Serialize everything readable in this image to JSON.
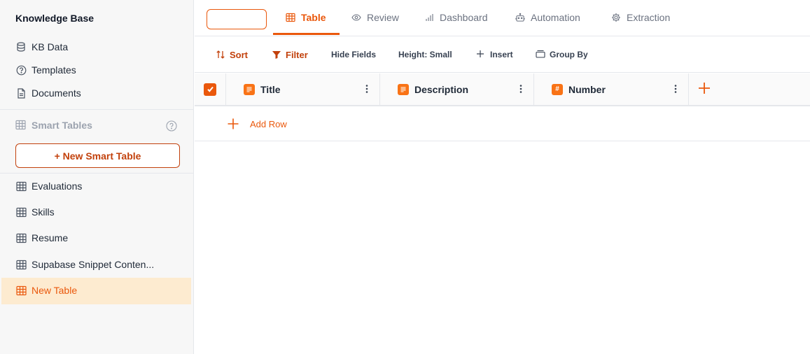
{
  "sidebar": {
    "title": "Knowledge Base",
    "nav": [
      {
        "label": "KB Data",
        "icon": "database-icon"
      },
      {
        "label": "Templates",
        "icon": "help-circle-icon"
      },
      {
        "label": "Documents",
        "icon": "document-icon"
      }
    ],
    "section_label": "Smart Tables",
    "new_table_label": "+ New Smart Table",
    "tables": [
      {
        "label": "Evaluations",
        "icon": "table-icon"
      },
      {
        "label": "Skills",
        "icon": "table-icon"
      },
      {
        "label": "Resume",
        "icon": "table-icon"
      },
      {
        "label": "Supabase Snippet Conten...",
        "icon": "table-icon"
      },
      {
        "label": "New Table",
        "icon": "table-icon",
        "active": true
      }
    ]
  },
  "header": {
    "name_input": {
      "value": "",
      "placeholder": ""
    },
    "tabs": [
      {
        "label": "Table",
        "icon": "table-icon",
        "active": true
      },
      {
        "label": "Review",
        "icon": "eye-icon"
      },
      {
        "label": "Dashboard",
        "icon": "bar-chart-icon"
      },
      {
        "label": "Automation",
        "icon": "robot-icon"
      },
      {
        "label": "Extraction",
        "icon": "gear-icon"
      }
    ]
  },
  "toolbar": {
    "sort": "Sort",
    "filter": "Filter",
    "hide_fields": "Hide Fields",
    "height": "Height: Small",
    "insert": "Insert",
    "group_by": "Group By"
  },
  "grid": {
    "columns": [
      {
        "label": "Title",
        "type": "text"
      },
      {
        "label": "Description",
        "type": "text"
      },
      {
        "label": "Number",
        "type": "number",
        "type_glyph": "#"
      }
    ],
    "add_row_label": "Add Row"
  },
  "colors": {
    "accent": "#ea580c",
    "accent_dark": "#c2410c",
    "active_bg": "#fdebd0",
    "sidebar_bg": "#f7f7f7"
  }
}
